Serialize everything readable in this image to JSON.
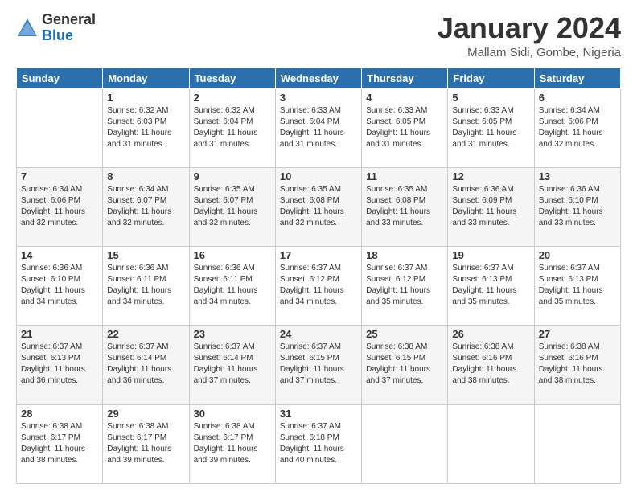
{
  "header": {
    "logo_general": "General",
    "logo_blue": "Blue",
    "month_title": "January 2024",
    "location": "Mallam Sidi, Gombe, Nigeria"
  },
  "weekdays": [
    "Sunday",
    "Monday",
    "Tuesday",
    "Wednesday",
    "Thursday",
    "Friday",
    "Saturday"
  ],
  "weeks": [
    [
      {
        "day": "",
        "info": ""
      },
      {
        "day": "1",
        "info": "Sunrise: 6:32 AM\nSunset: 6:03 PM\nDaylight: 11 hours\nand 31 minutes."
      },
      {
        "day": "2",
        "info": "Sunrise: 6:32 AM\nSunset: 6:04 PM\nDaylight: 11 hours\nand 31 minutes."
      },
      {
        "day": "3",
        "info": "Sunrise: 6:33 AM\nSunset: 6:04 PM\nDaylight: 11 hours\nand 31 minutes."
      },
      {
        "day": "4",
        "info": "Sunrise: 6:33 AM\nSunset: 6:05 PM\nDaylight: 11 hours\nand 31 minutes."
      },
      {
        "day": "5",
        "info": "Sunrise: 6:33 AM\nSunset: 6:05 PM\nDaylight: 11 hours\nand 31 minutes."
      },
      {
        "day": "6",
        "info": "Sunrise: 6:34 AM\nSunset: 6:06 PM\nDaylight: 11 hours\nand 32 minutes."
      }
    ],
    [
      {
        "day": "7",
        "info": "Sunrise: 6:34 AM\nSunset: 6:06 PM\nDaylight: 11 hours\nand 32 minutes."
      },
      {
        "day": "8",
        "info": "Sunrise: 6:34 AM\nSunset: 6:07 PM\nDaylight: 11 hours\nand 32 minutes."
      },
      {
        "day": "9",
        "info": "Sunrise: 6:35 AM\nSunset: 6:07 PM\nDaylight: 11 hours\nand 32 minutes."
      },
      {
        "day": "10",
        "info": "Sunrise: 6:35 AM\nSunset: 6:08 PM\nDaylight: 11 hours\nand 32 minutes."
      },
      {
        "day": "11",
        "info": "Sunrise: 6:35 AM\nSunset: 6:08 PM\nDaylight: 11 hours\nand 33 minutes."
      },
      {
        "day": "12",
        "info": "Sunrise: 6:36 AM\nSunset: 6:09 PM\nDaylight: 11 hours\nand 33 minutes."
      },
      {
        "day": "13",
        "info": "Sunrise: 6:36 AM\nSunset: 6:10 PM\nDaylight: 11 hours\nand 33 minutes."
      }
    ],
    [
      {
        "day": "14",
        "info": "Sunrise: 6:36 AM\nSunset: 6:10 PM\nDaylight: 11 hours\nand 34 minutes."
      },
      {
        "day": "15",
        "info": "Sunrise: 6:36 AM\nSunset: 6:11 PM\nDaylight: 11 hours\nand 34 minutes."
      },
      {
        "day": "16",
        "info": "Sunrise: 6:36 AM\nSunset: 6:11 PM\nDaylight: 11 hours\nand 34 minutes."
      },
      {
        "day": "17",
        "info": "Sunrise: 6:37 AM\nSunset: 6:12 PM\nDaylight: 11 hours\nand 34 minutes."
      },
      {
        "day": "18",
        "info": "Sunrise: 6:37 AM\nSunset: 6:12 PM\nDaylight: 11 hours\nand 35 minutes."
      },
      {
        "day": "19",
        "info": "Sunrise: 6:37 AM\nSunset: 6:13 PM\nDaylight: 11 hours\nand 35 minutes."
      },
      {
        "day": "20",
        "info": "Sunrise: 6:37 AM\nSunset: 6:13 PM\nDaylight: 11 hours\nand 35 minutes."
      }
    ],
    [
      {
        "day": "21",
        "info": "Sunrise: 6:37 AM\nSunset: 6:13 PM\nDaylight: 11 hours\nand 36 minutes."
      },
      {
        "day": "22",
        "info": "Sunrise: 6:37 AM\nSunset: 6:14 PM\nDaylight: 11 hours\nand 36 minutes."
      },
      {
        "day": "23",
        "info": "Sunrise: 6:37 AM\nSunset: 6:14 PM\nDaylight: 11 hours\nand 37 minutes."
      },
      {
        "day": "24",
        "info": "Sunrise: 6:37 AM\nSunset: 6:15 PM\nDaylight: 11 hours\nand 37 minutes."
      },
      {
        "day": "25",
        "info": "Sunrise: 6:38 AM\nSunset: 6:15 PM\nDaylight: 11 hours\nand 37 minutes."
      },
      {
        "day": "26",
        "info": "Sunrise: 6:38 AM\nSunset: 6:16 PM\nDaylight: 11 hours\nand 38 minutes."
      },
      {
        "day": "27",
        "info": "Sunrise: 6:38 AM\nSunset: 6:16 PM\nDaylight: 11 hours\nand 38 minutes."
      }
    ],
    [
      {
        "day": "28",
        "info": "Sunrise: 6:38 AM\nSunset: 6:17 PM\nDaylight: 11 hours\nand 38 minutes."
      },
      {
        "day": "29",
        "info": "Sunrise: 6:38 AM\nSunset: 6:17 PM\nDaylight: 11 hours\nand 39 minutes."
      },
      {
        "day": "30",
        "info": "Sunrise: 6:38 AM\nSunset: 6:17 PM\nDaylight: 11 hours\nand 39 minutes."
      },
      {
        "day": "31",
        "info": "Sunrise: 6:37 AM\nSunset: 6:18 PM\nDaylight: 11 hours\nand 40 minutes."
      },
      {
        "day": "",
        "info": ""
      },
      {
        "day": "",
        "info": ""
      },
      {
        "day": "",
        "info": ""
      }
    ]
  ]
}
